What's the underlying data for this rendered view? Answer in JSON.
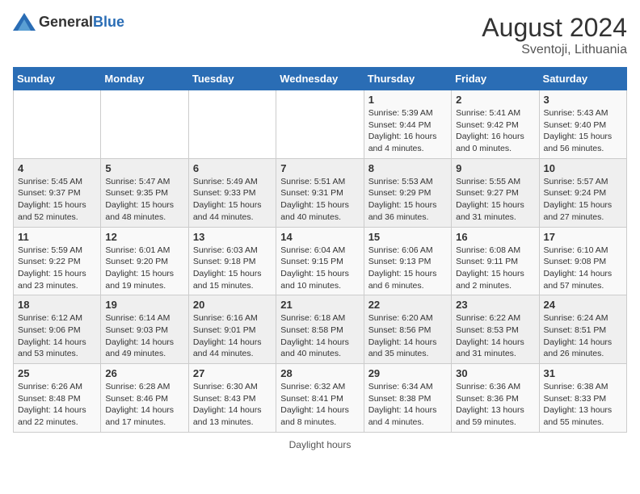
{
  "header": {
    "logo_general": "General",
    "logo_blue": "Blue",
    "month_year": "August 2024",
    "location": "Sventoji, Lithuania"
  },
  "days_of_week": [
    "Sunday",
    "Monday",
    "Tuesday",
    "Wednesday",
    "Thursday",
    "Friday",
    "Saturday"
  ],
  "weeks": [
    [
      {
        "day": "",
        "info": ""
      },
      {
        "day": "",
        "info": ""
      },
      {
        "day": "",
        "info": ""
      },
      {
        "day": "",
        "info": ""
      },
      {
        "day": "1",
        "info": "Sunrise: 5:39 AM\nSunset: 9:44 PM\nDaylight: 16 hours and 4 minutes."
      },
      {
        "day": "2",
        "info": "Sunrise: 5:41 AM\nSunset: 9:42 PM\nDaylight: 16 hours and 0 minutes."
      },
      {
        "day": "3",
        "info": "Sunrise: 5:43 AM\nSunset: 9:40 PM\nDaylight: 15 hours and 56 minutes."
      }
    ],
    [
      {
        "day": "4",
        "info": "Sunrise: 5:45 AM\nSunset: 9:37 PM\nDaylight: 15 hours and 52 minutes."
      },
      {
        "day": "5",
        "info": "Sunrise: 5:47 AM\nSunset: 9:35 PM\nDaylight: 15 hours and 48 minutes."
      },
      {
        "day": "6",
        "info": "Sunrise: 5:49 AM\nSunset: 9:33 PM\nDaylight: 15 hours and 44 minutes."
      },
      {
        "day": "7",
        "info": "Sunrise: 5:51 AM\nSunset: 9:31 PM\nDaylight: 15 hours and 40 minutes."
      },
      {
        "day": "8",
        "info": "Sunrise: 5:53 AM\nSunset: 9:29 PM\nDaylight: 15 hours and 36 minutes."
      },
      {
        "day": "9",
        "info": "Sunrise: 5:55 AM\nSunset: 9:27 PM\nDaylight: 15 hours and 31 minutes."
      },
      {
        "day": "10",
        "info": "Sunrise: 5:57 AM\nSunset: 9:24 PM\nDaylight: 15 hours and 27 minutes."
      }
    ],
    [
      {
        "day": "11",
        "info": "Sunrise: 5:59 AM\nSunset: 9:22 PM\nDaylight: 15 hours and 23 minutes."
      },
      {
        "day": "12",
        "info": "Sunrise: 6:01 AM\nSunset: 9:20 PM\nDaylight: 15 hours and 19 minutes."
      },
      {
        "day": "13",
        "info": "Sunrise: 6:03 AM\nSunset: 9:18 PM\nDaylight: 15 hours and 15 minutes."
      },
      {
        "day": "14",
        "info": "Sunrise: 6:04 AM\nSunset: 9:15 PM\nDaylight: 15 hours and 10 minutes."
      },
      {
        "day": "15",
        "info": "Sunrise: 6:06 AM\nSunset: 9:13 PM\nDaylight: 15 hours and 6 minutes."
      },
      {
        "day": "16",
        "info": "Sunrise: 6:08 AM\nSunset: 9:11 PM\nDaylight: 15 hours and 2 minutes."
      },
      {
        "day": "17",
        "info": "Sunrise: 6:10 AM\nSunset: 9:08 PM\nDaylight: 14 hours and 57 minutes."
      }
    ],
    [
      {
        "day": "18",
        "info": "Sunrise: 6:12 AM\nSunset: 9:06 PM\nDaylight: 14 hours and 53 minutes."
      },
      {
        "day": "19",
        "info": "Sunrise: 6:14 AM\nSunset: 9:03 PM\nDaylight: 14 hours and 49 minutes."
      },
      {
        "day": "20",
        "info": "Sunrise: 6:16 AM\nSunset: 9:01 PM\nDaylight: 14 hours and 44 minutes."
      },
      {
        "day": "21",
        "info": "Sunrise: 6:18 AM\nSunset: 8:58 PM\nDaylight: 14 hours and 40 minutes."
      },
      {
        "day": "22",
        "info": "Sunrise: 6:20 AM\nSunset: 8:56 PM\nDaylight: 14 hours and 35 minutes."
      },
      {
        "day": "23",
        "info": "Sunrise: 6:22 AM\nSunset: 8:53 PM\nDaylight: 14 hours and 31 minutes."
      },
      {
        "day": "24",
        "info": "Sunrise: 6:24 AM\nSunset: 8:51 PM\nDaylight: 14 hours and 26 minutes."
      }
    ],
    [
      {
        "day": "25",
        "info": "Sunrise: 6:26 AM\nSunset: 8:48 PM\nDaylight: 14 hours and 22 minutes."
      },
      {
        "day": "26",
        "info": "Sunrise: 6:28 AM\nSunset: 8:46 PM\nDaylight: 14 hours and 17 minutes."
      },
      {
        "day": "27",
        "info": "Sunrise: 6:30 AM\nSunset: 8:43 PM\nDaylight: 14 hours and 13 minutes."
      },
      {
        "day": "28",
        "info": "Sunrise: 6:32 AM\nSunset: 8:41 PM\nDaylight: 14 hours and 8 minutes."
      },
      {
        "day": "29",
        "info": "Sunrise: 6:34 AM\nSunset: 8:38 PM\nDaylight: 14 hours and 4 minutes."
      },
      {
        "day": "30",
        "info": "Sunrise: 6:36 AM\nSunset: 8:36 PM\nDaylight: 13 hours and 59 minutes."
      },
      {
        "day": "31",
        "info": "Sunrise: 6:38 AM\nSunset: 8:33 PM\nDaylight: 13 hours and 55 minutes."
      }
    ]
  ],
  "footer": {
    "note": "Daylight hours"
  }
}
